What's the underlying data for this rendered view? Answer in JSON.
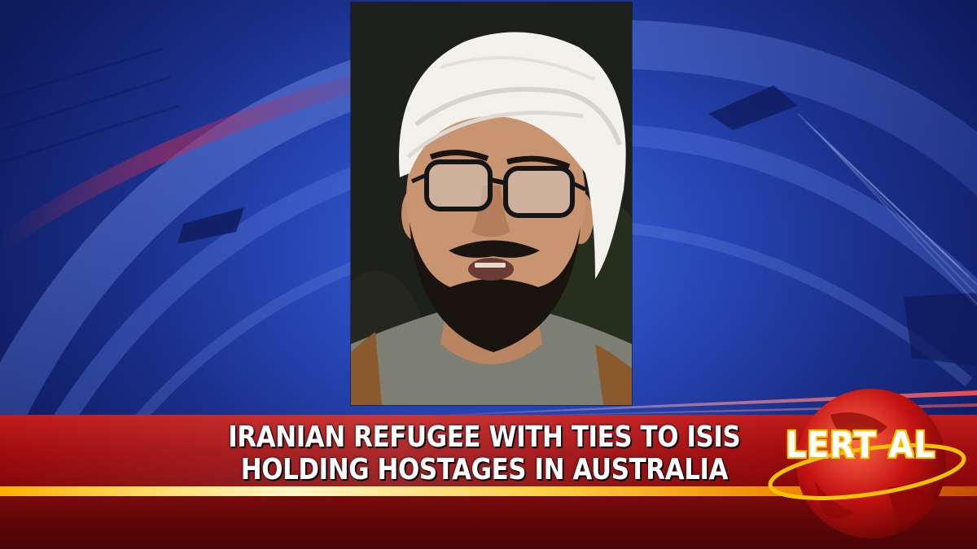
{
  "headline": {
    "line1": "IRANIAN REFUGEE WITH TIES TO ISIS",
    "line2": "HOLDING HOSTAGES IN AUSTRALIA"
  },
  "alert_logo": {
    "text": "LERT AL",
    "icon": "globe-icon"
  },
  "photo": {
    "subject": "man-in-white-turban-portrait"
  },
  "colors": {
    "background_blue": "#2848b8",
    "lower_third_red": "#a10d0f",
    "accent_gold": "#ffd24a",
    "text_white": "#ffffff"
  }
}
